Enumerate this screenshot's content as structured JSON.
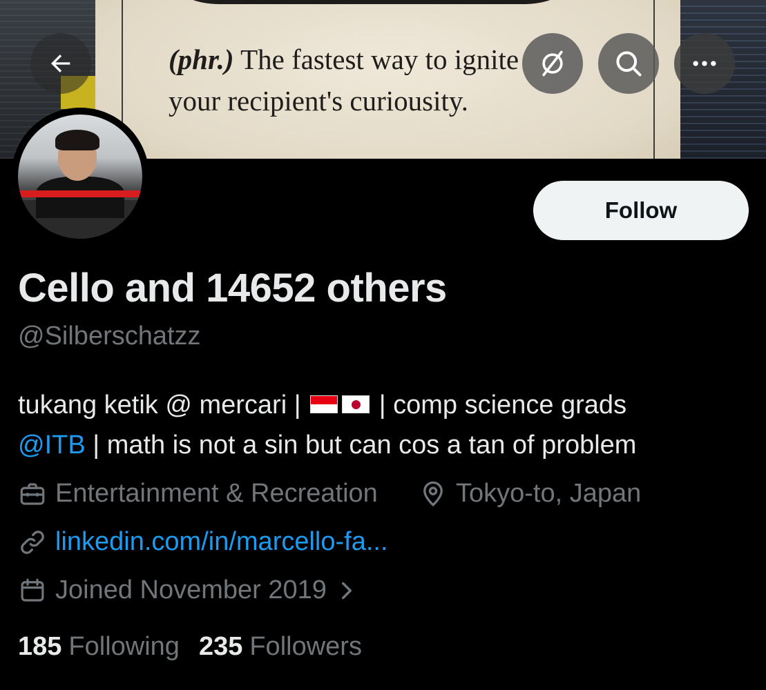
{
  "header": {
    "banner_text_prefix": "(phr.)",
    "banner_text": "The fastest way to ignite your recipient's curiousity."
  },
  "profile": {
    "follow_label": "Follow",
    "display_name": "Cello and 14652 others",
    "handle": "@Silberschatzz",
    "bio": {
      "part1": "tukang ketik @ mercari |",
      "part2": "| comp science grads",
      "mention": "@ITB",
      "part3": "| math is not a sin but can cos a tan of problem"
    },
    "category": "Entertainment & Recreation",
    "location": "Tokyo-to, Japan",
    "website": "linkedin.com/in/marcello-fa...",
    "joined": "Joined November 2019",
    "following_count": "185",
    "following_label": "Following",
    "followers_count": "235",
    "followers_label": "Followers"
  },
  "icons": {
    "back": "back-arrow-icon",
    "grok": "grok-icon",
    "search": "search-icon",
    "more": "more-icon",
    "category": "briefcase-icon",
    "location": "location-pin-icon",
    "link": "link-icon",
    "calendar": "calendar-icon",
    "chevron": "chevron-right-icon"
  },
  "colors": {
    "background": "#000000",
    "text_primary": "#e7e9ea",
    "text_secondary": "#71767b",
    "link": "#1d9bf0",
    "follow_bg": "#eff3f4"
  }
}
